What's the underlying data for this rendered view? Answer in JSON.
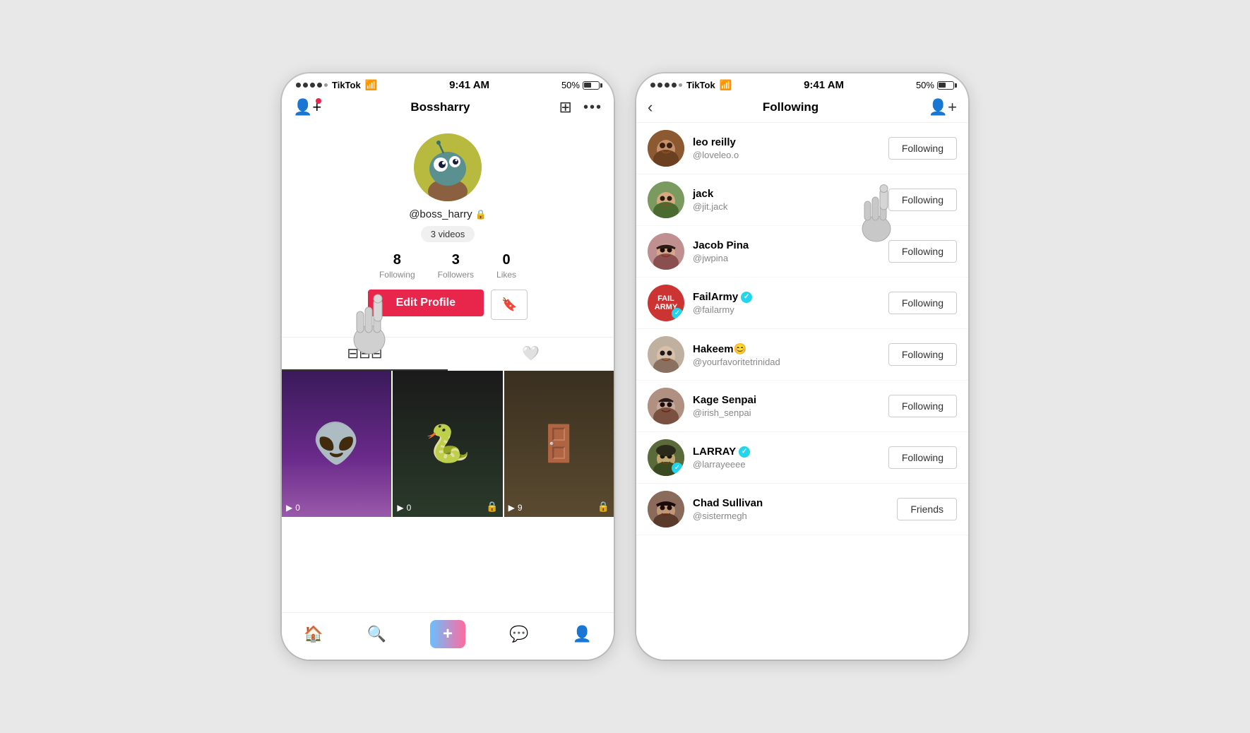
{
  "app": {
    "name": "TikTok"
  },
  "statusBar": {
    "signal": "●●●●○",
    "carrier": "TikTok",
    "wifi": "wifi",
    "time": "9:41 AM",
    "battery": "50%"
  },
  "profileScreen": {
    "title": "Bossharry",
    "handle": "@boss_harry",
    "videosBadge": "3 videos",
    "stats": [
      {
        "number": "8",
        "label": "Following"
      },
      {
        "number": "3",
        "label": "Followers"
      },
      {
        "number": "0",
        "label": "Likes"
      }
    ],
    "editProfileLabel": "Edit Profile",
    "videos": [
      {
        "views": "0",
        "icon": "alien"
      },
      {
        "views": "0",
        "icon": "snake",
        "locked": true
      },
      {
        "views": "9",
        "icon": "door",
        "locked": true
      }
    ],
    "nav": {
      "home": "home",
      "search": "search",
      "add": "+",
      "inbox": "inbox",
      "profile": "profile"
    }
  },
  "followingScreen": {
    "title": "Following",
    "users": [
      {
        "name": "leo reilly",
        "handle": "@loveleo.o",
        "avatar": "leo",
        "btnLabel": "Following",
        "verified": false
      },
      {
        "name": "jack",
        "handle": "@jit.jack",
        "avatar": "jack",
        "btnLabel": "Following",
        "verified": false
      },
      {
        "name": "Jacob Pina",
        "handle": "@jwpina",
        "avatar": "jacob",
        "btnLabel": "Following",
        "verified": false
      },
      {
        "name": "FailArmy",
        "handle": "@failarmy",
        "avatar": "failarmy",
        "btnLabel": "Following",
        "verified": true
      },
      {
        "name": "Hakeem😊",
        "handle": "@yourfavoritetrinidad",
        "avatar": "hakeem",
        "btnLabel": "Following",
        "verified": false
      },
      {
        "name": "Kage Senpai",
        "handle": "@irish_senpai",
        "avatar": "kage",
        "btnLabel": "Following",
        "verified": false
      },
      {
        "name": "LARRAY",
        "handle": "@larrayeeee",
        "avatar": "larray",
        "btnLabel": "Following",
        "verified": true
      },
      {
        "name": "Chad Sullivan",
        "handle": "@sistermegh",
        "avatar": "chad",
        "btnLabel": "Friends",
        "verified": false
      }
    ]
  }
}
